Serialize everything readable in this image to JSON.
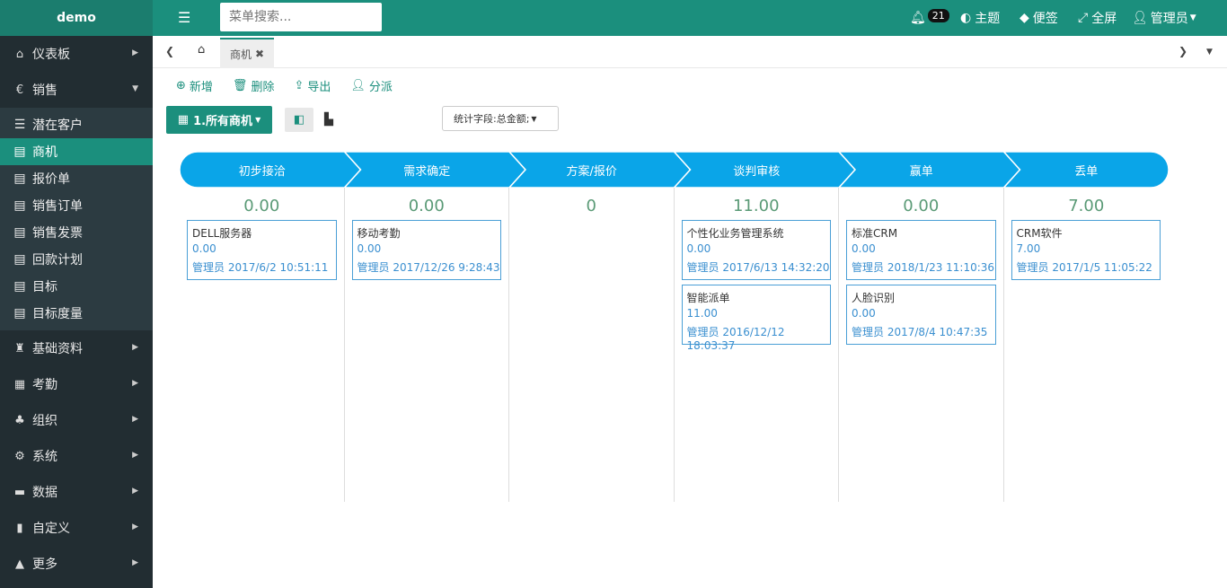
{
  "app": {
    "brand": "demo"
  },
  "sidebar": {
    "items_top": [
      {
        "label": "仪表板",
        "icon": "home-icon"
      },
      {
        "label": "销售",
        "icon": "euro-icon"
      }
    ],
    "sub_items": [
      {
        "label": "潜在客户"
      },
      {
        "label": "商机"
      },
      {
        "label": "报价单"
      },
      {
        "label": "销售订单"
      },
      {
        "label": "销售发票"
      },
      {
        "label": "回款计划"
      },
      {
        "label": "目标"
      },
      {
        "label": "目标度量"
      }
    ],
    "items_bottom": [
      {
        "label": "基础资料"
      },
      {
        "label": "考勤"
      },
      {
        "label": "组织"
      },
      {
        "label": "系统"
      },
      {
        "label": "数据"
      },
      {
        "label": "自定义"
      },
      {
        "label": "更多"
      }
    ]
  },
  "topbar": {
    "search_placeholder": "菜单搜索...",
    "notif_count": "21",
    "theme": "主题",
    "notes": "便签",
    "fullscreen": "全屏",
    "user": "管理员"
  },
  "tabs": {
    "active": "商机"
  },
  "toolbar": {
    "add": "新增",
    "delete": "删除",
    "export": "导出",
    "assign": "分派"
  },
  "view": {
    "label": "1.所有商机",
    "stat_select": "统计字段:总金额;"
  },
  "stages": [
    {
      "name": "初步接洽",
      "total": "0.00",
      "cards": [
        {
          "name": "DELL服务器",
          "amount": "0.00",
          "owner": "管理员 2017/6/2 10:51:11"
        }
      ]
    },
    {
      "name": "需求确定",
      "total": "0.00",
      "cards": [
        {
          "name": "移动考勤",
          "amount": "0.00",
          "owner": "管理员 2017/12/26 9:28:43"
        }
      ]
    },
    {
      "name": "方案/报价",
      "total": "0",
      "cards": []
    },
    {
      "name": "谈判审核",
      "total": "11.00",
      "cards": [
        {
          "name": "个性化业务管理系统",
          "amount": "0.00",
          "owner": "管理员 2017/6/13 14:32:20"
        },
        {
          "name": "智能派单",
          "amount": "11.00",
          "owner": "管理员 2016/12/12 18:03:37"
        }
      ]
    },
    {
      "name": "赢单",
      "total": "0.00",
      "cards": [
        {
          "name": "标准CRM",
          "amount": "0.00",
          "owner": "管理员 2018/1/23 11:10:36"
        },
        {
          "name": "人脸识别",
          "amount": "0.00",
          "owner": "管理员 2017/8/4 10:47:35"
        }
      ]
    },
    {
      "name": "丢单",
      "total": "7.00",
      "cards": [
        {
          "name": "CRM软件",
          "amount": "7.00",
          "owner": "管理员 2017/1/5 11:05:22"
        }
      ]
    }
  ],
  "colors": {
    "accent": "#1b8f7d",
    "stage_fill": "#0aa5e8",
    "card_border": "#4a9fd6"
  }
}
